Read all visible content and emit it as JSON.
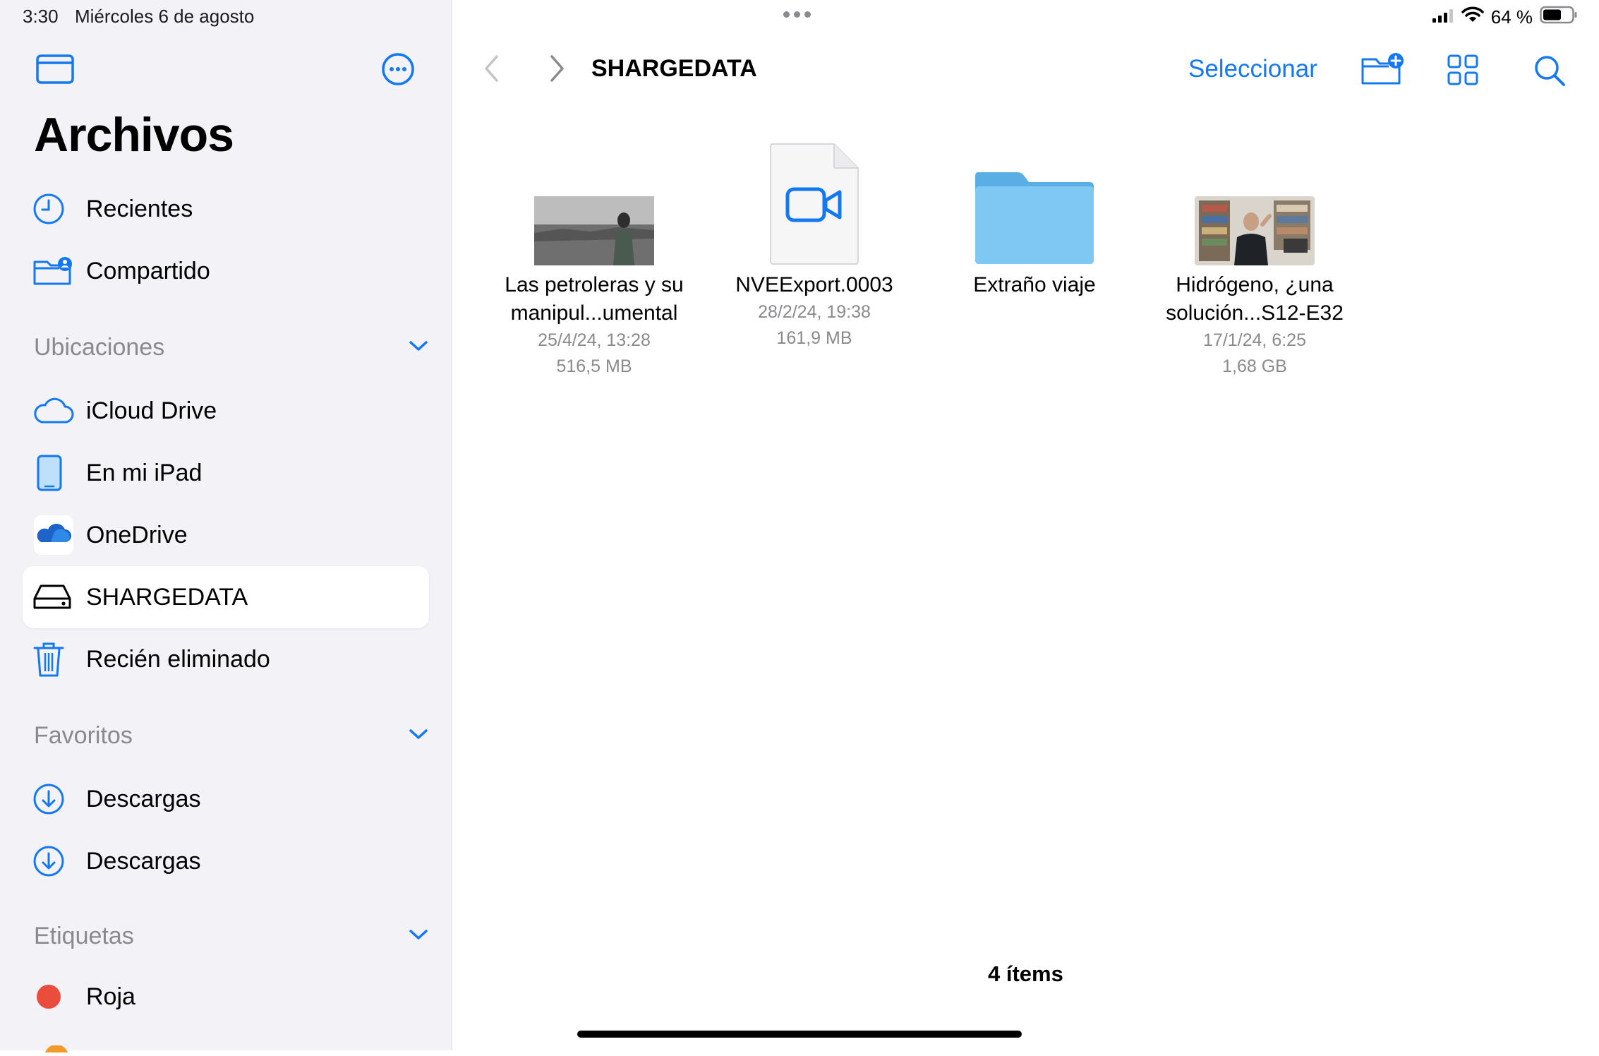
{
  "status": {
    "time": "3:30",
    "date": "Miércoles 6 de agosto",
    "battery_pct": "64 %",
    "battery_level": 0.64
  },
  "colors": {
    "accent": "#1478f0",
    "folder": "#6fbff0",
    "red_tag": "#eb4d3d"
  },
  "sidebar": {
    "title": "Archivos",
    "top_items": [
      {
        "label": "Recientes",
        "icon": "clock-icon"
      },
      {
        "label": "Compartido",
        "icon": "shared-folder-icon"
      }
    ],
    "sections": [
      {
        "title": "Ubicaciones",
        "items": [
          {
            "label": "iCloud Drive",
            "icon": "cloud-icon"
          },
          {
            "label": "En mi iPad",
            "icon": "ipad-icon"
          },
          {
            "label": "OneDrive",
            "icon": "onedrive-icon"
          },
          {
            "label": "SHARGEDATA",
            "icon": "drive-icon",
            "selected": true
          },
          {
            "label": "Recién eliminado",
            "icon": "trash-icon"
          }
        ]
      },
      {
        "title": "Favoritos",
        "items": [
          {
            "label": "Descargas",
            "icon": "download-icon"
          },
          {
            "label": "Descargas",
            "icon": "download-icon"
          }
        ]
      },
      {
        "title": "Etiquetas",
        "items": [
          {
            "label": "Roja",
            "icon": "red-tag-icon"
          }
        ]
      }
    ]
  },
  "toolbar": {
    "title": "SHARGEDATA",
    "select_label": "Seleccionar",
    "icons": [
      "back-icon",
      "forward-icon",
      "new-folder-icon",
      "grid-view-icon",
      "search-icon"
    ]
  },
  "files": [
    {
      "name_line1": "Las petroleras y su",
      "name_line2": "manipul...umental",
      "date": "25/4/24, 13:28",
      "size": "516,5 MB",
      "kind": "video-thumbnail"
    },
    {
      "name_line1": "NVEExport.0003",
      "name_line2": "",
      "date": "28/2/24, 19:38",
      "size": "161,9 MB",
      "kind": "video-file"
    },
    {
      "name_line1": "Extraño viaje",
      "name_line2": "",
      "date": "",
      "size": "",
      "kind": "folder"
    },
    {
      "name_line1": "Hidrógeno, ¿una",
      "name_line2": "solución...S12-E32",
      "date": "17/1/24, 6:25",
      "size": "1,68 GB",
      "kind": "video-thumbnail"
    }
  ],
  "footer": {
    "count": "4 ítems"
  }
}
